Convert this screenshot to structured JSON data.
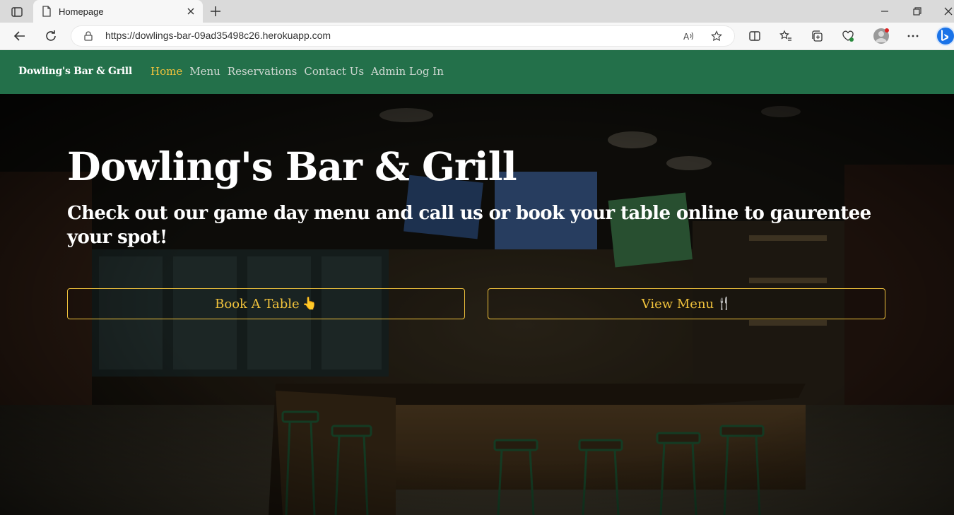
{
  "browser": {
    "tab_title": "Homepage",
    "url": "https://dowlings-bar-09ad35498c26.herokuapp.com"
  },
  "site": {
    "brand": "Dowling's Bar & Grill",
    "nav": [
      {
        "label": "Home",
        "active": true
      },
      {
        "label": "Menu",
        "active": false
      },
      {
        "label": "Reservations",
        "active": false
      },
      {
        "label": "Contact Us",
        "active": false
      },
      {
        "label": "Admin Log In",
        "active": false
      }
    ],
    "colors": {
      "nav_bg": "#23704a",
      "accent": "#f0c23c"
    }
  },
  "hero": {
    "title": "Dowling's Bar & Grill",
    "subtitle": "Check out our game day menu and call us or book your table online to gaurentee your spot!",
    "book_button": {
      "label": "Book A Table",
      "icon": "pointing-hand-icon",
      "glyph": "👆"
    },
    "menu_button": {
      "label": "View Menu",
      "icon": "fork-knife-icon",
      "glyph": "🍴"
    }
  }
}
